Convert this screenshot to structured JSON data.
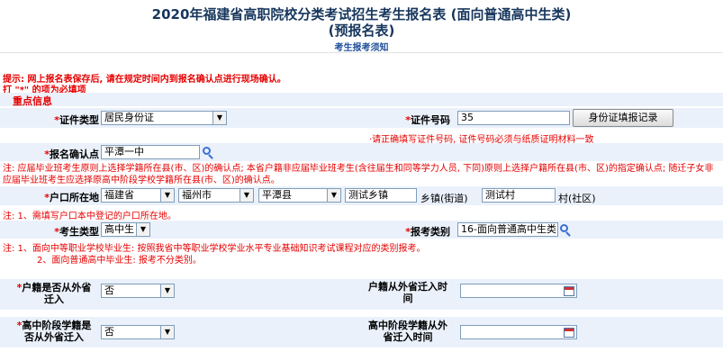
{
  "header": {
    "title_line1": "2020年福建省高职院校分类考试招生考生报名表 (面向普通高中生类)",
    "title_line2": "(预报名表)",
    "notice_link": "考生报考须知"
  },
  "tips": {
    "line1": "提示: 网上报名表保存后, 请在规定时间内到报名确认点进行现场确认。",
    "line2": "打 \"*\" 的项为必填项"
  },
  "section_title": "重点信息",
  "id_type": {
    "label": "证件类型",
    "value": "居民身份证"
  },
  "id_number": {
    "label": "证件号码",
    "value": "35",
    "button": "身份证填报记录",
    "hint": "·请正确填写证件号码, 证件号码必须与纸质证明材料一致"
  },
  "confirm_point": {
    "label": "报名确认点",
    "value": "平潭一中"
  },
  "note1": "注: 应届毕业班考生原则上选择学籍所在县(市、区)的确认点; 本省户籍非应届毕业班考生(含往届生和同等学力人员, 下同)原则上选择户籍所在县(市、区)的指定确认点; 随迁子女非应届毕业班考生应选择原高中阶段学校学籍所在县(市、区)的确认点。",
  "household": {
    "label": "户口所在地",
    "province": "福建省",
    "city": "福州市",
    "county": "平潭县",
    "town_value": "测试乡镇",
    "town_label": "乡镇(街道)",
    "village_value": "测试村",
    "village_label": "村(社区)"
  },
  "note2": "注: 1、需填写户口本中登记的户口所在地。",
  "candidate_type": {
    "label": "考生类型",
    "value": "高中生"
  },
  "exam_category": {
    "label": "报考类别",
    "value": "16-面向普通高中生类"
  },
  "note3_line1": "注: 1、面向中等职业学校毕业生: 按照我省中等职业学校学业水平专业基础知识考试课程对应的类别报考。",
  "note3_line2": "2、面向普通高中毕业生: 报考不分类别。",
  "household_migrate": {
    "label": "户籍是否从外省迁入",
    "value": "否",
    "time_label": "户籍从外省迁入时间",
    "time_value": ""
  },
  "school_migrate": {
    "label": "高中阶段学籍是否从外省迁入",
    "value": "否",
    "time_label": "高中阶段学籍从外省迁入时间",
    "time_value": ""
  },
  "colors": {
    "accent_red": "#e60000",
    "title_blue": "#17365d",
    "band_bg": "#eaf1fb"
  }
}
